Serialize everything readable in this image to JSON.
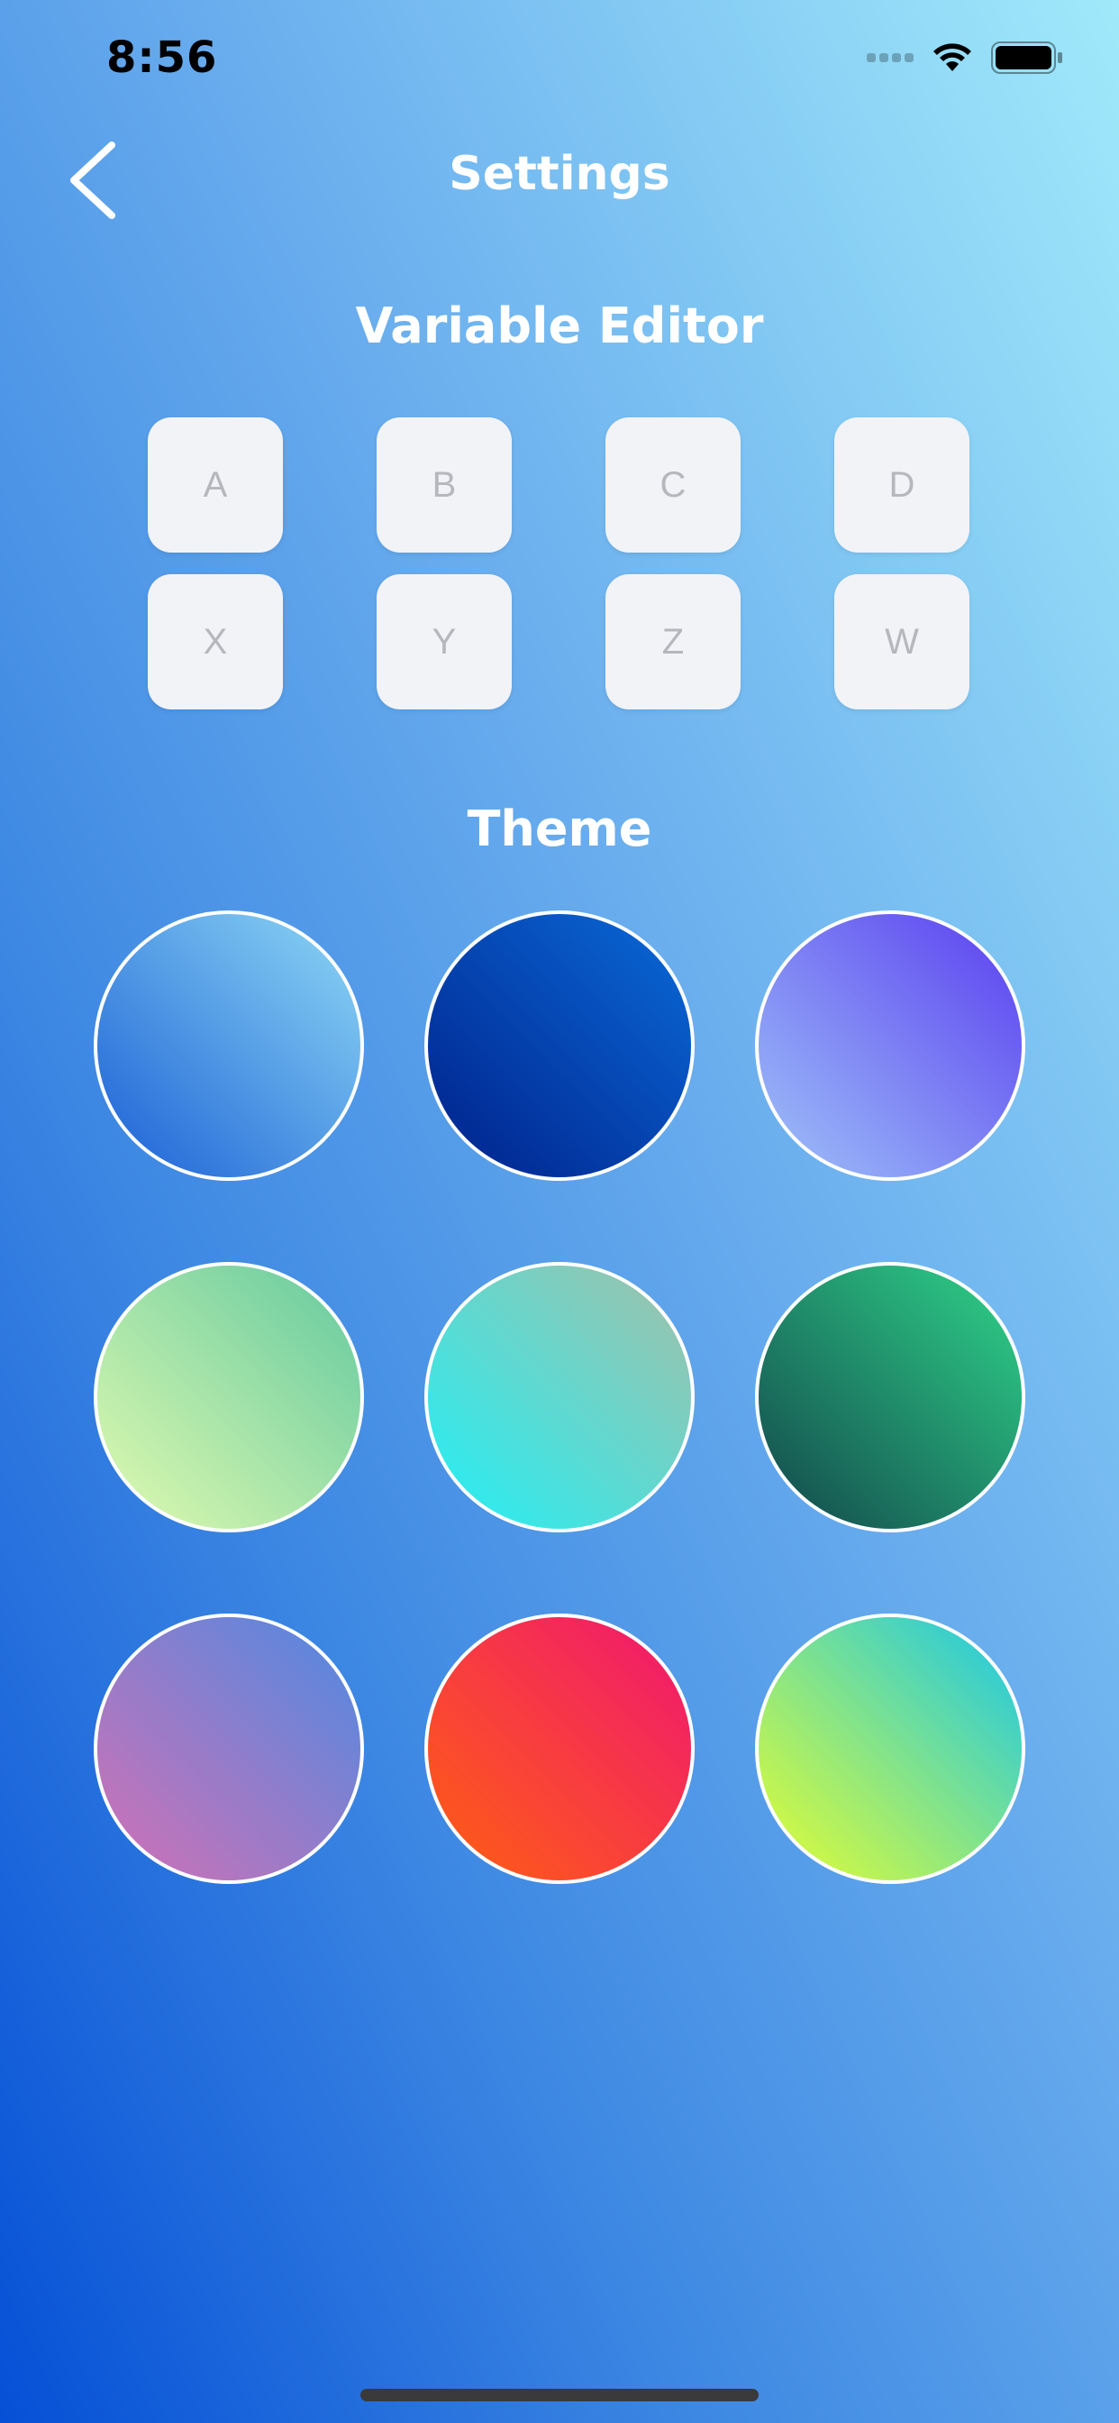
{
  "status_bar": {
    "time": "8:56"
  },
  "header": {
    "title": "Settings"
  },
  "variable_editor": {
    "title": "Variable Editor",
    "keys": [
      "A",
      "B",
      "C",
      "D",
      "X",
      "Y",
      "Z",
      "W"
    ]
  },
  "theme": {
    "title": "Theme",
    "swatches": [
      {
        "name": "sky-blue",
        "from": "#1a5fd6",
        "to": "#8ed8f5"
      },
      {
        "name": "deep-blue",
        "from": "#00208a",
        "to": "#0a6ad8"
      },
      {
        "name": "violet",
        "from": "#9fc3f8",
        "to": "#5a3ef0"
      },
      {
        "name": "lime-mint",
        "from": "#e2fbb0",
        "to": "#62c9a0"
      },
      {
        "name": "cyan-sage",
        "from": "#20f0f6",
        "to": "#a3bfa8"
      },
      {
        "name": "forest-green",
        "from": "#12454a",
        "to": "#2fd48a"
      },
      {
        "name": "orchid",
        "from": "#d370b4",
        "to": "#4e8ae2"
      },
      {
        "name": "sunset-red",
        "from": "#ff6010",
        "to": "#f01672"
      },
      {
        "name": "lime-teal",
        "from": "#e8ff30",
        "to": "#18c6ea"
      }
    ]
  }
}
